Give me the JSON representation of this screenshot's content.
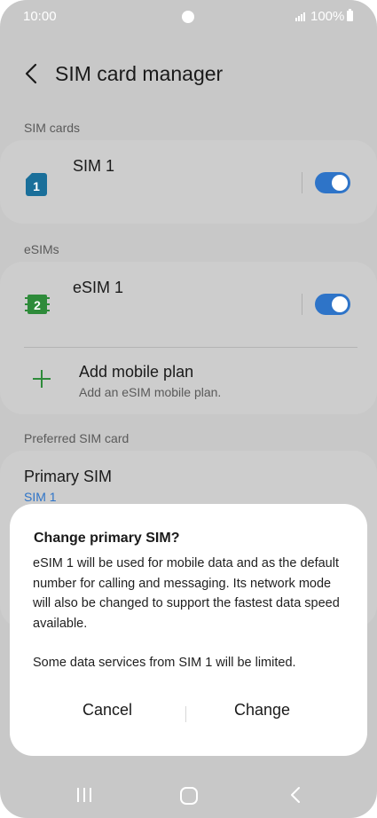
{
  "status": {
    "time": "10:00",
    "battery": "100%"
  },
  "header": {
    "title": "SIM card manager"
  },
  "sim_cards": {
    "section_label": "SIM cards",
    "sim1": {
      "icon_number": "1",
      "name": "SIM 1",
      "enabled": true,
      "accent": "#1a6f9a"
    }
  },
  "esims": {
    "section_label": "eSIMs",
    "esim1": {
      "icon_number": "2",
      "name": "eSIM 1",
      "enabled": true,
      "accent": "#2e8b3a"
    },
    "add_plan": {
      "title": "Add mobile plan",
      "subtitle": "Add an eSIM mobile plan."
    }
  },
  "preferred": {
    "section_label": "Preferred SIM card",
    "primary": {
      "title": "Primary SIM",
      "value": "SIM 1"
    }
  },
  "dialog": {
    "title": "Change primary SIM?",
    "body1": "eSIM 1 will be used for mobile data and as the default number for calling and messaging. Its network mode will also be changed to support the fastest data speed available.",
    "body2": "Some data services from SIM 1 will be limited.",
    "cancel_label": "Cancel",
    "confirm_label": "Change"
  },
  "colors": {
    "toggle_on": "#2e74c8",
    "link": "#2e74c8"
  }
}
